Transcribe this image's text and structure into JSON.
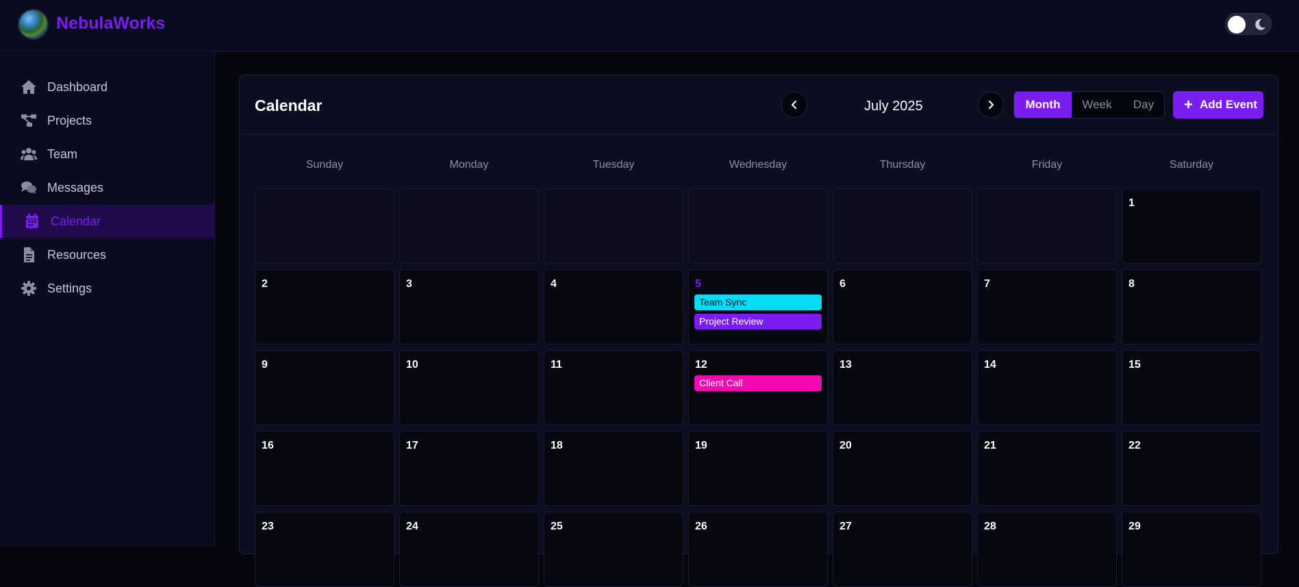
{
  "app": {
    "brand": "NebulaWorks"
  },
  "colors": {
    "accent": "#7a1cf2",
    "event_cyan": "#06dcf5",
    "event_purple": "#7a1cf2",
    "event_pink": "#f10aaf"
  },
  "sidebar": {
    "items": [
      {
        "label": "Dashboard",
        "icon": "home-icon",
        "active": false
      },
      {
        "label": "Projects",
        "icon": "project-diagram-icon",
        "active": false
      },
      {
        "label": "Team",
        "icon": "users-icon",
        "active": false
      },
      {
        "label": "Messages",
        "icon": "comments-icon",
        "active": false
      },
      {
        "label": "Calendar",
        "icon": "calendar-icon",
        "active": true
      },
      {
        "label": "Resources",
        "icon": "file-icon",
        "active": false
      },
      {
        "label": "Settings",
        "icon": "gear-icon",
        "active": false
      }
    ]
  },
  "calendar": {
    "title": "Calendar",
    "month_label": "July 2025",
    "views": [
      "Month",
      "Week",
      "Day"
    ],
    "active_view": "Month",
    "add_event_label": "Add Event",
    "weekdays": [
      "Sunday",
      "Monday",
      "Tuesday",
      "Wednesday",
      "Thursday",
      "Friday",
      "Saturday"
    ],
    "today": "5",
    "weeks": [
      [
        "",
        "",
        "",
        "",
        "",
        "",
        "1"
      ],
      [
        "2",
        "3",
        "4",
        "5",
        "6",
        "7",
        "8"
      ],
      [
        "9",
        "10",
        "11",
        "12",
        "13",
        "14",
        "15"
      ],
      [
        "16",
        "17",
        "18",
        "19",
        "20",
        "21",
        "22"
      ],
      [
        "23",
        "24",
        "25",
        "26",
        "27",
        "28",
        "29"
      ]
    ],
    "events": [
      {
        "day": "5",
        "title": "Team Sync",
        "color": "#06dcf5",
        "text_color": "#0b0b1f"
      },
      {
        "day": "5",
        "title": "Project Review",
        "color": "#7a1cf2",
        "text_color": "#ffffff"
      },
      {
        "day": "12",
        "title": "Client Call",
        "color": "#f10aaf",
        "text_color": "#ffffff"
      }
    ]
  }
}
